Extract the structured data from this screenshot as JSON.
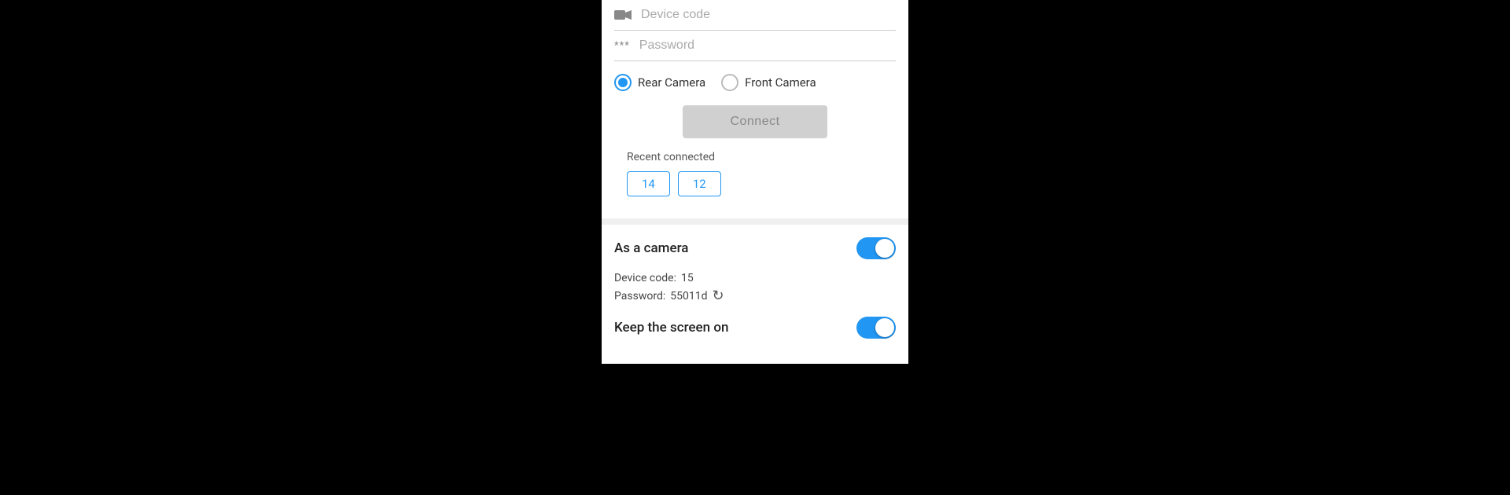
{
  "panel": {
    "top_section": {
      "device_code_placeholder": "Device code",
      "password_placeholder": "Password"
    },
    "camera_options": {
      "rear_label": "Rear Camera",
      "front_label": "Front Camera",
      "selected": "rear"
    },
    "connect_button_label": "Connect",
    "recent_section": {
      "label": "Recent connected",
      "chips": [
        "14",
        "12"
      ]
    },
    "bottom_section": {
      "as_camera_label": "As a camera",
      "as_camera_toggle": "on",
      "device_code_label": "Device code:",
      "device_code_value": "15",
      "password_label": "Password:",
      "password_value": "55011d",
      "keep_screen_label": "Keep the screen on",
      "keep_screen_toggle": "on"
    }
  },
  "icons": {
    "camera_icon": "📹",
    "password_icon": "***",
    "refresh_icon": "↻"
  }
}
